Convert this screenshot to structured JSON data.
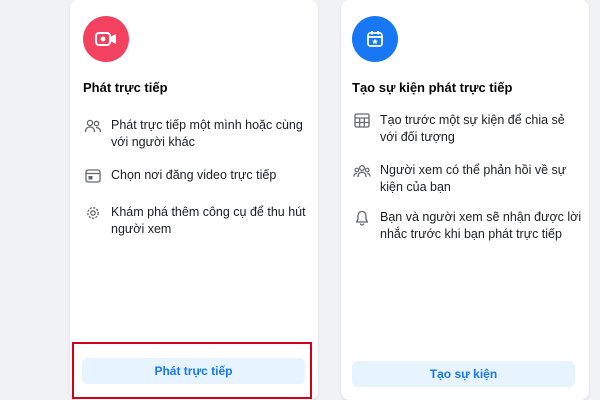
{
  "colors": {
    "live_accent": "#f3425f",
    "event_accent": "#1877f2",
    "button_bg": "#e7f3ff",
    "button_text": "#1877f2",
    "highlight": "#d0021b"
  },
  "left_card": {
    "icon": "live-video-icon",
    "title": "Phát trực tiếp",
    "features": [
      {
        "icon": "people-icon",
        "text": "Phát trực tiếp một mình hoặc cùng với người khác"
      },
      {
        "icon": "feed-icon",
        "text": "Chọn nơi đăng video trực tiếp"
      },
      {
        "icon": "gear-icon",
        "text": "Khám phá thêm công cụ để thu hút người xem"
      }
    ],
    "button_label": "Phát trực tiếp"
  },
  "right_card": {
    "icon": "calendar-star-icon",
    "title": "Tạo sự kiện phát trực tiếp",
    "features": [
      {
        "icon": "calendar-grid-icon",
        "text": "Tạo trước một sự kiện để chia sẻ với đối tượng"
      },
      {
        "icon": "group-icon",
        "text": "Người xem có thể phản hồi về sự kiện của bạn"
      },
      {
        "icon": "bell-icon",
        "text": "Bạn và người xem sẽ nhận được lời nhắc trước khi bạn phát trực tiếp"
      }
    ],
    "button_label": "Tạo sự kiện"
  }
}
